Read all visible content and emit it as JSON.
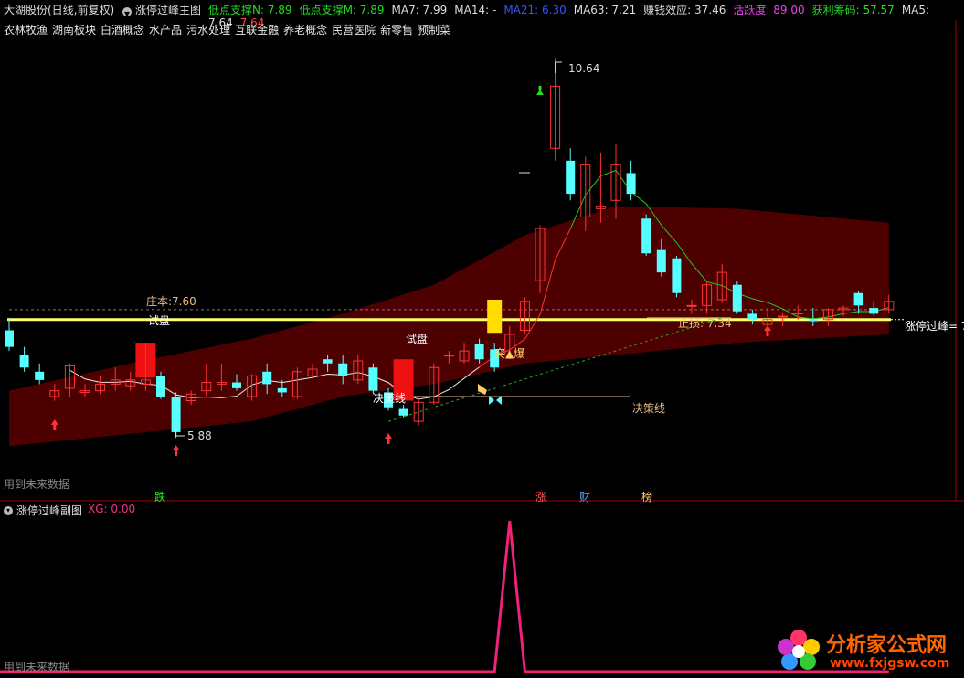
{
  "header": {
    "stock_name": "大湖股份(日线,前复权)",
    "indicator_name": "涨停过峰主图",
    "items": [
      {
        "label": "低点支撑N: 7.89",
        "color": "#22dd22"
      },
      {
        "label": "低点支撑M: 7.89",
        "color": "#22dd22"
      },
      {
        "label": "MA7: 7.99",
        "color": "#dddddd"
      },
      {
        "label": "MA14: -",
        "color": "#dddddd"
      },
      {
        "label": "MA21: 6.30",
        "color": "#3355ff"
      },
      {
        "label": "MA63: 7.21",
        "color": "#dddddd"
      },
      {
        "label": "赚钱效应: 37.46",
        "color": "#dddddd"
      },
      {
        "label": "活跃度: 89.00",
        "color": "#ee44ee"
      },
      {
        "label": "获利筹码: 57.57",
        "color": "#22dd22"
      },
      {
        "label": "MA5: 7.64",
        "color": "#dddddd"
      },
      {
        "label": "7.64",
        "color": "#ff4444"
      }
    ]
  },
  "sectors": [
    "农林牧渔",
    "湖南板块",
    "白酒概念",
    "水产品",
    "污水处理",
    "互联金融",
    "养老概念",
    "民营医院",
    "新零售",
    "预制菜"
  ],
  "annotations": {
    "high_price": "10.64",
    "low_price": "5.88",
    "zhuangben": "庄本:7.60",
    "shipan_left": "试盘",
    "shipan_mid": "试盘",
    "juece_left": "决策线",
    "juece_right": "决策线",
    "zhisun": "止损: 7.34",
    "tupo": "突▲爆",
    "guofeng": "涨停过峰= 7"
  },
  "labels": {
    "future_data_main": "用到未来数据",
    "future_data_sub": "用到未来数据",
    "die": "跌",
    "zhang": "涨",
    "cai": "财",
    "bang": "榜"
  },
  "subchart": {
    "title": "涨停过峰副图",
    "xg_label": "XG: 0.00"
  },
  "logo": {
    "name": "分析家公式网",
    "url": "www.fxjgsw.com"
  },
  "chart_data": {
    "type": "candlestick",
    "price_range": [
      5.6,
      10.9
    ],
    "candles": [
      {
        "o": 7.35,
        "h": 7.5,
        "l": 7.1,
        "c": 7.15,
        "up": false
      },
      {
        "o": 7.05,
        "h": 7.15,
        "l": 6.85,
        "c": 6.9,
        "up": false
      },
      {
        "o": 6.85,
        "h": 6.95,
        "l": 6.7,
        "c": 6.75,
        "up": false
      },
      {
        "o": 6.55,
        "h": 6.7,
        "l": 6.5,
        "c": 6.62,
        "up": true
      },
      {
        "o": 6.65,
        "h": 6.95,
        "l": 6.55,
        "c": 6.92,
        "up": true
      },
      {
        "o": 6.6,
        "h": 6.7,
        "l": 6.55,
        "c": 6.62,
        "up": true
      },
      {
        "o": 6.62,
        "h": 6.8,
        "l": 6.58,
        "c": 6.7,
        "up": true
      },
      {
        "o": 6.7,
        "h": 6.9,
        "l": 6.62,
        "c": 6.75,
        "up": true
      },
      {
        "o": 6.75,
        "h": 6.85,
        "l": 6.62,
        "c": 6.68,
        "up": true
      },
      {
        "o": 6.7,
        "h": 7.2,
        "l": 6.62,
        "c": 6.75,
        "up": true
      },
      {
        "o": 6.8,
        "h": 6.85,
        "l": 6.52,
        "c": 6.55,
        "up": false
      },
      {
        "o": 6.55,
        "h": 6.6,
        "l": 6.05,
        "c": 6.12,
        "up": false
      },
      {
        "o": 6.5,
        "h": 6.62,
        "l": 6.45,
        "c": 6.58,
        "up": true
      },
      {
        "o": 6.62,
        "h": 6.95,
        "l": 6.55,
        "c": 6.72,
        "up": true
      },
      {
        "o": 6.72,
        "h": 6.95,
        "l": 6.62,
        "c": 6.7,
        "up": true
      },
      {
        "o": 6.72,
        "h": 6.82,
        "l": 6.62,
        "c": 6.65,
        "up": false
      },
      {
        "o": 6.55,
        "h": 6.82,
        "l": 6.5,
        "c": 6.8,
        "up": true
      },
      {
        "o": 6.7,
        "h": 6.95,
        "l": 6.58,
        "c": 6.85,
        "up": false
      },
      {
        "o": 6.65,
        "h": 6.75,
        "l": 6.55,
        "c": 6.6,
        "up": false
      },
      {
        "o": 6.55,
        "h": 6.9,
        "l": 6.52,
        "c": 6.85,
        "up": true
      },
      {
        "o": 6.88,
        "h": 6.95,
        "l": 6.78,
        "c": 6.8,
        "up": true
      },
      {
        "o": 6.95,
        "h": 7.05,
        "l": 6.85,
        "c": 7.0,
        "up": false
      },
      {
        "o": 6.95,
        "h": 7.05,
        "l": 6.7,
        "c": 6.8,
        "up": false
      },
      {
        "o": 6.98,
        "h": 7.05,
        "l": 6.7,
        "c": 6.75,
        "up": true
      },
      {
        "o": 6.9,
        "h": 6.95,
        "l": 6.58,
        "c": 6.62,
        "up": false
      },
      {
        "o": 6.6,
        "h": 6.65,
        "l": 6.38,
        "c": 6.42,
        "up": false
      },
      {
        "o": 6.4,
        "h": 6.45,
        "l": 6.3,
        "c": 6.32,
        "up": false
      },
      {
        "o": 6.25,
        "h": 6.55,
        "l": 6.2,
        "c": 6.48,
        "up": true
      },
      {
        "o": 6.48,
        "h": 6.95,
        "l": 6.45,
        "c": 6.9,
        "up": true
      },
      {
        "o": 7.05,
        "h": 7.1,
        "l": 6.95,
        "c": 7.05,
        "up": true
      },
      {
        "o": 6.98,
        "h": 7.2,
        "l": 6.95,
        "c": 7.1,
        "up": true
      },
      {
        "o": 7.18,
        "h": 7.25,
        "l": 6.95,
        "c": 7.0,
        "up": false
      },
      {
        "o": 6.9,
        "h": 7.2,
        "l": 6.85,
        "c": 7.12,
        "up": false
      },
      {
        "o": 7.05,
        "h": 7.4,
        "l": 7.0,
        "c": 7.3,
        "up": true
      },
      {
        "o": 7.35,
        "h": 7.75,
        "l": 7.3,
        "c": 7.7,
        "up": true
      },
      {
        "o": 7.95,
        "h": 8.62,
        "l": 7.8,
        "c": 8.58,
        "up": true
      },
      {
        "o": 9.55,
        "h": 10.64,
        "l": 9.4,
        "c": 10.3,
        "up": true
      },
      {
        "o": 9.4,
        "h": 9.55,
        "l": 8.92,
        "c": 9.0,
        "up": false
      },
      {
        "o": 8.72,
        "h": 9.45,
        "l": 8.55,
        "c": 9.35,
        "up": true
      },
      {
        "o": 8.82,
        "h": 9.5,
        "l": 8.65,
        "c": 8.85,
        "up": true
      },
      {
        "o": 9.35,
        "h": 9.6,
        "l": 8.7,
        "c": 8.92,
        "up": true
      },
      {
        "o": 9.25,
        "h": 9.4,
        "l": 8.92,
        "c": 9.0,
        "up": false
      },
      {
        "o": 8.7,
        "h": 8.75,
        "l": 8.25,
        "c": 8.28,
        "up": false
      },
      {
        "o": 8.32,
        "h": 8.45,
        "l": 8.0,
        "c": 8.05,
        "up": false
      },
      {
        "o": 8.22,
        "h": 8.25,
        "l": 7.75,
        "c": 7.8,
        "up": false
      },
      {
        "o": 7.65,
        "h": 7.72,
        "l": 7.55,
        "c": 7.65,
        "up": true
      },
      {
        "o": 7.65,
        "h": 7.95,
        "l": 7.55,
        "c": 7.9,
        "up": true
      },
      {
        "o": 7.72,
        "h": 8.15,
        "l": 7.68,
        "c": 8.05,
        "up": true
      },
      {
        "o": 7.9,
        "h": 7.95,
        "l": 7.55,
        "c": 7.58,
        "up": false
      },
      {
        "o": 7.55,
        "h": 7.6,
        "l": 7.42,
        "c": 7.48,
        "up": false
      },
      {
        "o": 7.48,
        "h": 7.62,
        "l": 7.4,
        "c": 7.42,
        "up": true
      },
      {
        "o": 7.52,
        "h": 7.56,
        "l": 7.4,
        "c": 7.52,
        "up": true
      },
      {
        "o": 7.56,
        "h": 7.65,
        "l": 7.48,
        "c": 7.56,
        "up": true
      },
      {
        "o": 7.48,
        "h": 7.62,
        "l": 7.4,
        "c": 7.46,
        "up": false
      },
      {
        "o": 7.48,
        "h": 7.62,
        "l": 7.4,
        "c": 7.6,
        "up": true
      },
      {
        "o": 7.6,
        "h": 7.65,
        "l": 7.52,
        "c": 7.62,
        "up": true
      },
      {
        "o": 7.8,
        "h": 7.82,
        "l": 7.55,
        "c": 7.65,
        "up": false
      },
      {
        "o": 7.62,
        "h": 7.7,
        "l": 7.52,
        "c": 7.55,
        "up": false
      },
      {
        "o": 7.6,
        "h": 7.78,
        "l": 7.55,
        "c": 7.7,
        "up": true
      }
    ],
    "xg_series": [
      0,
      0,
      0,
      0,
      0,
      0,
      0,
      0,
      0,
      0,
      0,
      0,
      0,
      0,
      0,
      0,
      0,
      0,
      0,
      0,
      0,
      0,
      0,
      0,
      0,
      0,
      0,
      0,
      0,
      0,
      0,
      0,
      0,
      1,
      0,
      0,
      0,
      0,
      0,
      0,
      0,
      0,
      0,
      0,
      0,
      0,
      0,
      0,
      0,
      0,
      0,
      0,
      0,
      0,
      0,
      0,
      0,
      0,
      0
    ],
    "xg_range": [
      0,
      1
    ],
    "ma_short_color": "#e8e8e8",
    "ma_long_color": "#22cc22",
    "band_color": "#5a0000",
    "up_color": "#ff3333",
    "down_color": "#55ffff"
  }
}
